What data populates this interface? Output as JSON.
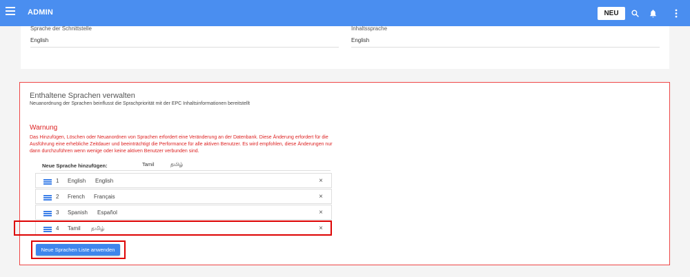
{
  "header": {
    "title": "ADMIN",
    "new_button": "NEU",
    "icons": [
      "menu-icon",
      "search-icon",
      "bell-icon",
      "more-vert-icon"
    ],
    "accent": "#4a8ef0"
  },
  "settings": {
    "interface_language_label": "Sprache der Schnittstelle",
    "interface_language_value": "English",
    "content_language_label": "Inhaltssprache",
    "content_language_value": "English"
  },
  "languages_panel": {
    "title": "Enthaltene Sprachen verwalten",
    "subtitle": "Neuanordnung der Sprachen beinflusst die Sprachpriorität mit der EPC Inhaltsinformationen bereitstellt",
    "warning_title": "Warnung",
    "warning_text": "Das Hinzufügen, Löschen oder Neuanordnen von Sprachen erfordert eine Veränderung an der Datenbank. Diese Änderung erfordert für die Ausführung eine erhebliche Zeitdauer und beeinträchtigt die Performance für alle aktiven Benutzer. Es wird empfohlen, diese Änderungen nur dann durchzuführen wenn wenige oder keine aktiven Benutzer verbunden sind.",
    "add_language_label": "Neue Sprache hinzufügen:",
    "add_language_name": "Tamil",
    "add_language_native": "தமிழ்",
    "languages": [
      {
        "num": "1",
        "name": "English",
        "native": "English"
      },
      {
        "num": "2",
        "name": "French",
        "native": "Français"
      },
      {
        "num": "3",
        "name": "Spanish",
        "native": "Español"
      },
      {
        "num": "4",
        "name": "Tamil",
        "native": "தமிழ்"
      }
    ],
    "remove_symbol": "×",
    "apply_button": "Neue Sprachen Liste anwenden"
  }
}
